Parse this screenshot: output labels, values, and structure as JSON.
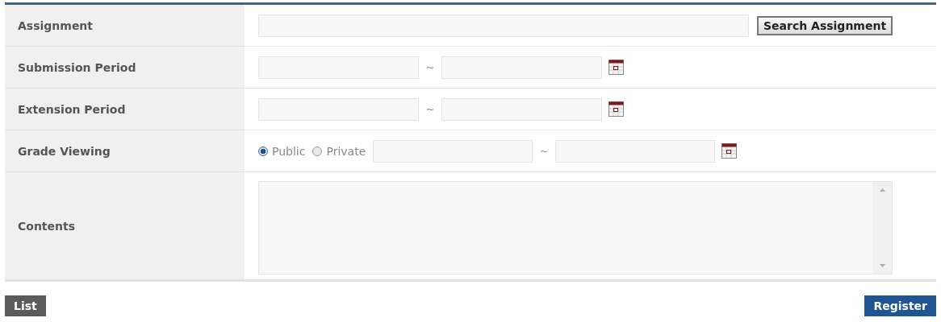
{
  "form": {
    "rows": [
      {
        "kind": "search",
        "label": "Assignment",
        "button": "Search Assignment"
      },
      {
        "kind": "period",
        "label": "Submission Period",
        "separator": "~"
      },
      {
        "kind": "period",
        "label": "Extension Period",
        "separator": "~"
      },
      {
        "kind": "grade",
        "label": "Grade Viewing",
        "options": [
          {
            "label": "Public",
            "selected": true
          },
          {
            "label": "Private",
            "selected": false
          }
        ],
        "separator": "~"
      },
      {
        "kind": "textarea",
        "label": "Contents"
      }
    ]
  },
  "buttons": {
    "left": "List",
    "right": "Register"
  }
}
